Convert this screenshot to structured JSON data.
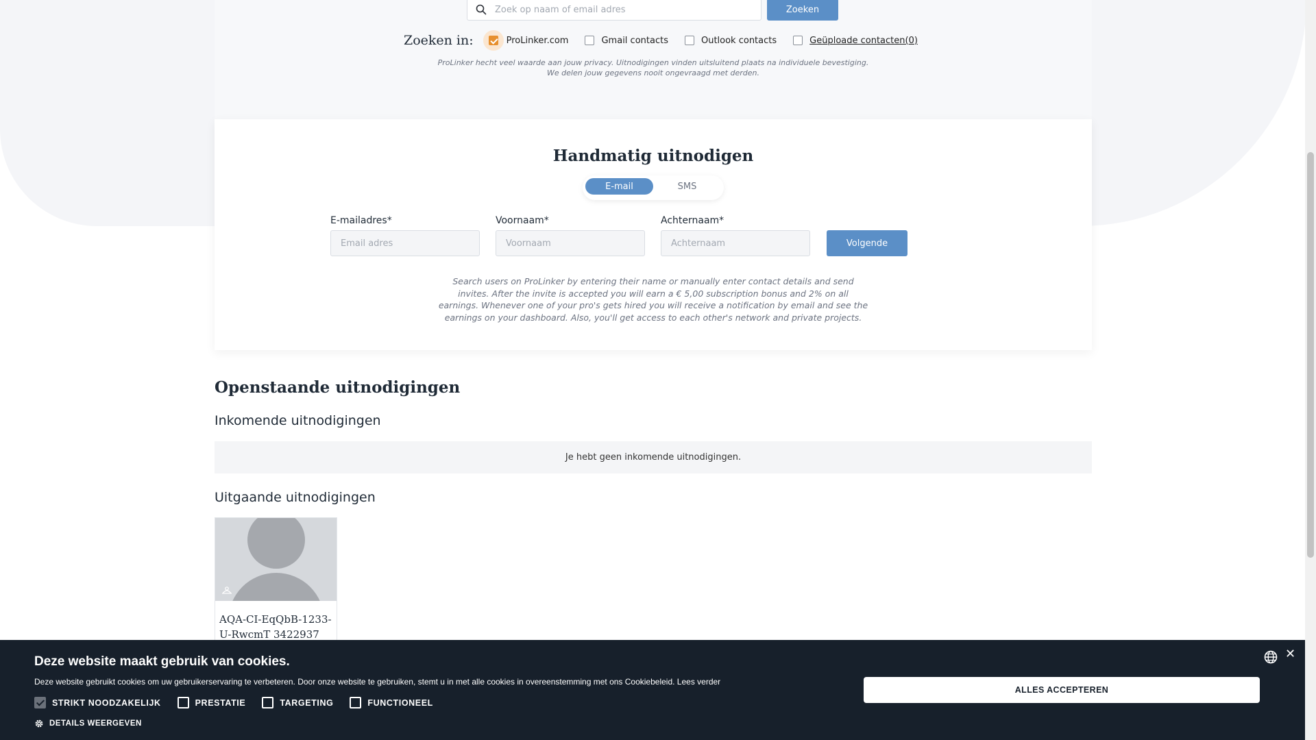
{
  "search": {
    "placeholder": "Zoek op naam of email adres",
    "button_label": "Zoeken",
    "search_in_label": "Zoeken in:",
    "sources": [
      {
        "label": "ProLinker.com",
        "checked": true
      },
      {
        "label": "Gmail contacts",
        "checked": false
      },
      {
        "label": "Outlook contacts",
        "checked": false
      },
      {
        "label": "Geüploade contacten(0)",
        "checked": false
      }
    ],
    "privacy_line1": "ProLinker hecht veel waarde aan jouw privacy. Uitnodigingen vinden uitsluitend plaats na individuele bevestiging.",
    "privacy_line2": "We delen jouw gegevens nooit ongevraagd met derden."
  },
  "manual": {
    "title": "Handmatig uitnodigen",
    "tabs": [
      {
        "label": "E-mail",
        "active": true
      },
      {
        "label": "SMS",
        "active": false
      }
    ],
    "email_label": "E-mailadres*",
    "email_placeholder": "Email adres",
    "firstname_label": "Voornaam*",
    "firstname_placeholder": "Voornaam",
    "lastname_label": "Achternaam*",
    "lastname_placeholder": "Achternaam",
    "next_label": "Volgende",
    "help_text": "Search users on ProLinker by entering their name or manually enter contact details and send invites. After the invite is accepted you will earn a € 5,00 subscription bonus and 2% on all earnings. Whenever one of your pro's gets hired you will receive a notification by email and see the earnings on your dashboard. Also, you'll get access to each other's network and private projects."
  },
  "pending": {
    "title": "Openstaande uitnodigingen",
    "incoming_title": "Inkomende uitnodigingen",
    "incoming_empty": "Je hebt geen inkomende uitnodigingen.",
    "outgoing_title": "Uitgaande uitnodigingen",
    "outgoing": [
      {
        "name": "AQA-CI-EqQbB-1233-U-RwcmT 3422937"
      }
    ]
  },
  "cookie": {
    "title": "Deze website maakt gebruik van cookies.",
    "text": "Deze website gebruikt cookies om uw gebruikerservaring te verbeteren. Door onze website te gebruiken, stemt u in met alle cookies in overeenstemming met ons Cookiebeleid. Lees verder",
    "options": [
      {
        "label": "STRIKT NOODZAKELIJK",
        "checked": true,
        "disabled": true
      },
      {
        "label": "PRESTATIE",
        "checked": false
      },
      {
        "label": "TARGETING",
        "checked": false
      },
      {
        "label": "FUNCTIONEEL",
        "checked": false
      }
    ],
    "details_label": "DETAILS WEERGEVEN",
    "accept_label": "ALLES ACCEPTEREN"
  },
  "colors": {
    "accent": "#5b8fc7",
    "checkbox": "#e7902f",
    "cookie_bg": "#17202b"
  }
}
